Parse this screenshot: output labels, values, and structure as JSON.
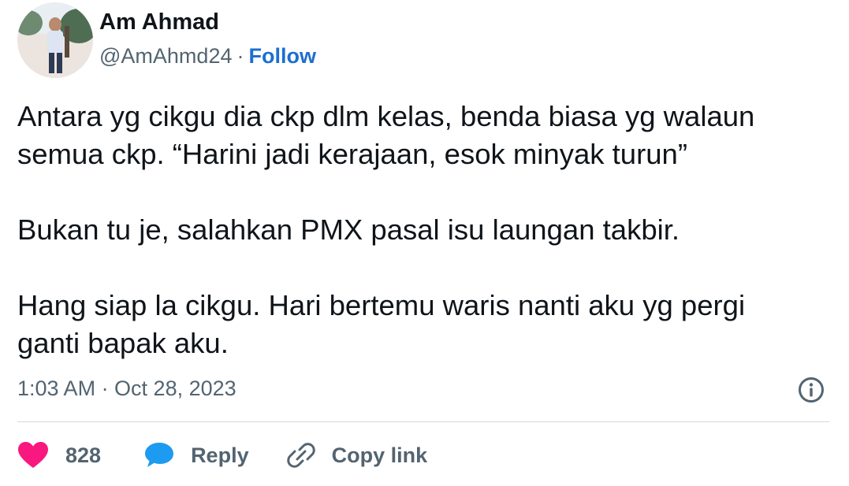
{
  "tweet": {
    "author": {
      "display_name": "Am Ahmad",
      "handle": "@AmAhmd24",
      "separator": "·",
      "follow_label": "Follow"
    },
    "text_paragraphs": [
      [
        "Antara yg cikgu dia ckp dlm kelas, benda biasa yg walaun",
        "semua ckp. “Harini jadi kerajaan, esok minyak turun”"
      ],
      [
        "Bukan tu je, salahkan PMX pasal isu laungan takbir."
      ],
      [
        "Hang siap la cikgu. Hari bertemu waris nanti aku yg pergi",
        "ganti bapak aku."
      ]
    ],
    "timestamp": "1:03 AM · Oct 28, 2023",
    "actions": {
      "like_count": "828",
      "reply_label": "Reply",
      "copy_link_label": "Copy link"
    },
    "icons": {
      "like": "heart-icon",
      "reply": "speech-bubble-icon",
      "copy_link": "link-icon",
      "info": "info-icon"
    },
    "colors": {
      "follow": "#1d6fd0",
      "heart": "#f91880",
      "reply_bubble": "#1d9bf0",
      "secondary_text": "#536471"
    }
  }
}
